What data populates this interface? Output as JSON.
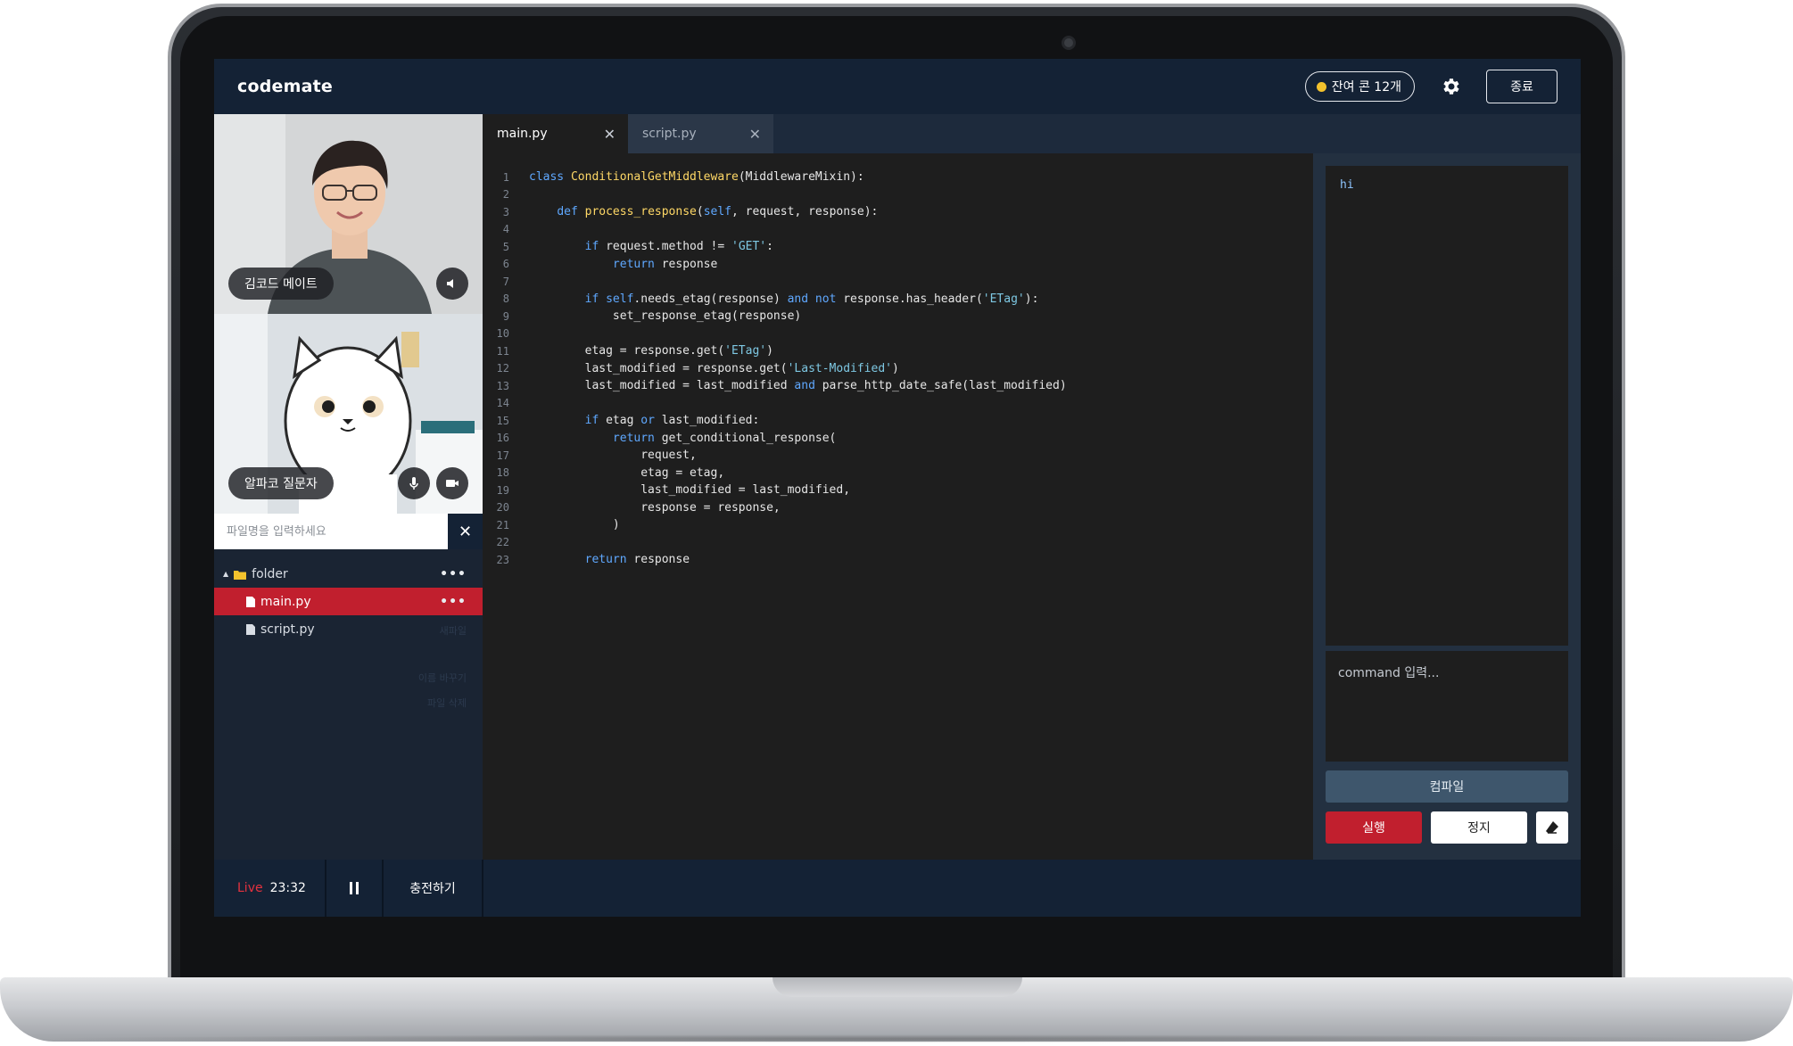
{
  "app": {
    "logo": "codemate"
  },
  "header": {
    "coins_label": "잔여 콘 12개",
    "end_label": "종료"
  },
  "participants": [
    {
      "name": "김코드 메이트"
    },
    {
      "name": "알파코 질문자"
    }
  ],
  "file_search": {
    "placeholder": "파일명을 입력하세요",
    "close": "✕"
  },
  "file_tree": {
    "folder": "folder",
    "files": [
      "main.py",
      "script.py"
    ],
    "ghost_labels": [
      "새파일",
      "이름 바꾸기",
      "파일 삭제"
    ]
  },
  "tabs": [
    {
      "label": "main.py",
      "close": "✕"
    },
    {
      "label": "script.py",
      "close": "✕"
    }
  ],
  "editor": {
    "language": "python",
    "lines": [
      "class ConditionalGetMiddleware(MiddlewareMixin):",
      "",
      "    def process_response(self, request, response):",
      "",
      "        if request.method != 'GET':",
      "            return response",
      "",
      "        if self.needs_etag(response) and not response.has_header('ETag'):",
      "            set_response_etag(response)",
      "",
      "        etag = response.get('ETag')",
      "        last_modified = response.get('Last-Modified')",
      "        last_modified = last_modified and parse_http_date_safe(last_modified)",
      "",
      "        if etag or last_modified:",
      "            return get_conditional_response(",
      "                request,",
      "                etag = etag,",
      "                last_modified = last_modified,",
      "                response = response,",
      "            )",
      "",
      "        return response"
    ]
  },
  "console": {
    "output": "hi",
    "command_placeholder": "command 입력...",
    "compile_label": "컴파일",
    "run_label": "실행",
    "stop_label": "정지"
  },
  "status_bar": {
    "live_label": "Live",
    "timer": "23:32",
    "charge_label": "충전하기"
  },
  "colors": {
    "navy": "#142235",
    "accent_red": "#c11f2e",
    "coin": "#f3c22d"
  }
}
